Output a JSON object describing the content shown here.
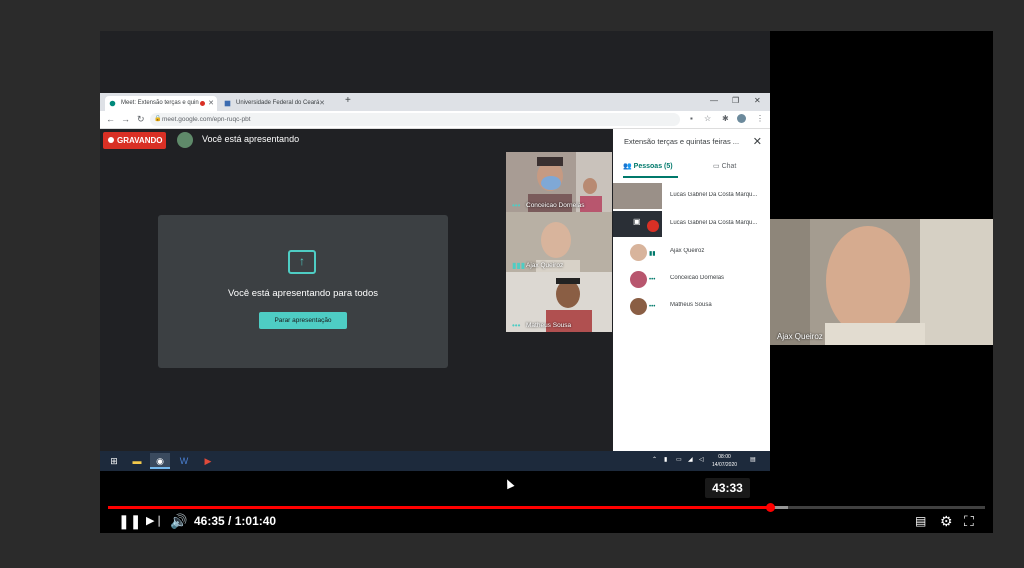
{
  "player": {
    "seek_tooltip": "43:33",
    "time_current": "46:35",
    "time_separator": " / ",
    "time_total": "1:01:40",
    "played_fraction": 0.755,
    "buffered_fraction": 0.775
  },
  "browser": {
    "tabs": [
      {
        "title": "Meet: Extensão terças e quin",
        "active": true,
        "recording": true
      },
      {
        "title": "Universidade Federal do Ceará -",
        "active": false
      }
    ],
    "url": "meet.google.com/epn-ruqc-pbt"
  },
  "meet": {
    "rec_label": "GRAVANDO",
    "presenting_text": "Você está apresentando",
    "card_title": "Você está apresentando para todos",
    "stop_button": "Parar apresentação",
    "tiles": [
      {
        "name": "Conceicao Dornelas"
      },
      {
        "name": "Ajax Queiroz"
      },
      {
        "name": "Matheus Sousa"
      }
    ],
    "panel": {
      "title": "Extensão terças e quintas feiras ...",
      "tab_people": "Pessoas (5)",
      "tab_chat": "Chat",
      "people": [
        {
          "name": "Lucas Gabriel Da Costa Marqu..."
        },
        {
          "name": "Lucas Gabriel Da Costa Marqu..."
        },
        {
          "name": "Ajax Queiroz"
        },
        {
          "name": "Conceicao Dornelas"
        },
        {
          "name": "Matheus Sousa"
        }
      ]
    }
  },
  "taskbar": {
    "clock_time": "08:00",
    "clock_date": "14/07/2020"
  },
  "side_video": {
    "name": "Ajax Queiroz"
  },
  "colors": {
    "accent": "#4ecdc4",
    "record": "#d93025",
    "progress": "#ff0000"
  }
}
